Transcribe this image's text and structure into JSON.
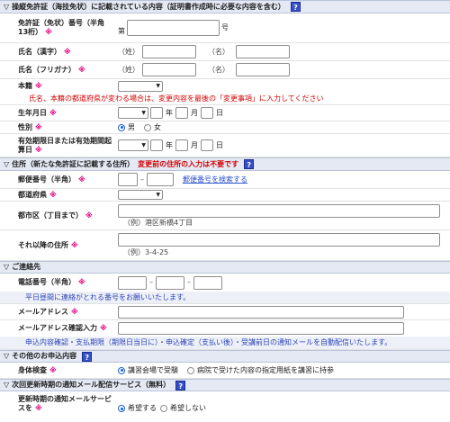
{
  "sections": {
    "license": {
      "title": "操縦免許証（海技免状）に記載されている内容（証明書作成時に必要な内容を含む）",
      "help": "?"
    },
    "address": {
      "title": "住所（新たな免許証に記載する住所）",
      "note_red": "変更前の住所の入力は不要です",
      "help": "?"
    },
    "contact": {
      "title": "ご連絡先"
    },
    "other": {
      "title": "その他のお申込内容",
      "help": "?"
    },
    "mail_service": {
      "title": "次回更新時期の通知メール配信サービス（無料）",
      "help": "?"
    }
  },
  "required_mark": "※",
  "license": {
    "number_label": "免許証（免状）番号（半角13桁）",
    "number_prefix": "第",
    "number_suffix": "号",
    "kanji_label": "氏名（漢字）",
    "kana_label": "氏名（フリガナ）",
    "family_label": "（姓）",
    "given_label": "（名）",
    "honseki_label": "本籍",
    "honseki_note": "氏名、本籍の都道府県が変わる場合は、変更内容を最後の「変更事項」に入力してください",
    "birth_label": "生年月日",
    "gender_label": "性別",
    "gender_options": [
      "男",
      "女"
    ],
    "gender_selected": "男",
    "expiry_label": "有効期限日または有効期間起算日",
    "year": "年",
    "month": "月",
    "day": "日"
  },
  "address": {
    "postal_label": "郵便番号（半角）",
    "postal_link": "郵便番号を検索する",
    "pref_label": "都道府県",
    "city_label": "都市区（丁目まで）",
    "city_example": "（例）港区新橋4丁目",
    "rest_label": "それ以降の住所",
    "rest_example": "（例）3-4-25"
  },
  "contact": {
    "phone_label": "電話番号（半角）",
    "phone_note": "平日昼間に連絡がとれる番号をお願いいたします。",
    "email_label": "メールアドレス",
    "email_confirm_label": "メールアドレス確認入力",
    "email_note": "申込内容確認・支払期限（期限日当日に）・申込確定（支払い後）・受講前日の通知メールを自動配信いたします。"
  },
  "other": {
    "exam_label": "身体検査",
    "exam_options": [
      "講習会場で受験",
      "病院で受けた内容の指定用紙を講習に持参"
    ],
    "exam_selected": 0
  },
  "mail_service": {
    "label": "更新時期の通知メールサービスを",
    "options": [
      "希望する",
      "希望しない"
    ],
    "selected": 0
  }
}
